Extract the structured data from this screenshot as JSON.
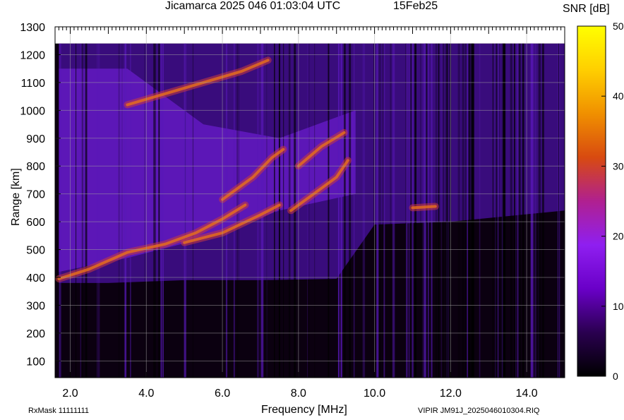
{
  "title": {
    "left": "Jicamarca 2025 046 01:03:04 UTC",
    "right": "15Feb25"
  },
  "footer": {
    "left": "RxMask 11111111",
    "right": "VIPIR  JM91J_2025046010304.RIQ"
  },
  "chart_data": {
    "type": "heatmap",
    "title": "Jicamarca 2025 046 01:03:04 UTC",
    "xlabel": "Frequency [MHz]",
    "ylabel": "Range [km]",
    "xlim": [
      1.6,
      15.0
    ],
    "ylim": [
      40,
      1300
    ],
    "x_ticks": [
      2.0,
      4.0,
      6.0,
      8.0,
      10.0,
      12.0,
      14.0
    ],
    "x_tick_labels": [
      "2.0",
      "4.0",
      "6.0",
      "8.0",
      "10.0",
      "12.0",
      "14.0"
    ],
    "y_ticks": [
      100,
      200,
      300,
      400,
      500,
      600,
      700,
      800,
      900,
      1000,
      1100,
      1200,
      1300
    ],
    "y_tick_labels": [
      "100",
      "200",
      "300",
      "400",
      "500",
      "600",
      "700",
      "800",
      "900",
      "1000",
      "1100",
      "1200",
      "1300"
    ],
    "grid": true,
    "data_range_max_km": 1240,
    "colorbar": {
      "label": "SNR [dB]",
      "min": 0,
      "max": 50,
      "ticks": [
        0,
        10,
        20,
        30,
        40,
        50
      ],
      "tick_labels": [
        "0",
        "10",
        "20",
        "30",
        "40",
        "50"
      ],
      "colors": [
        "#000000",
        "#2a0050",
        "#6a00c8",
        "#8f1ff0",
        "#b02090",
        "#d84a10",
        "#f09000",
        "#ffcf00",
        "#ffff00"
      ]
    },
    "traces": [
      {
        "x": [
          1.7,
          2.5,
          3.5,
          4.5,
          5.3,
          6.0,
          6.6
        ],
        "y": [
          395,
          430,
          490,
          520,
          560,
          610,
          660
        ]
      },
      {
        "x": [
          5.0,
          6.0,
          7.0,
          7.5
        ],
        "y": [
          525,
          560,
          625,
          660
        ]
      },
      {
        "x": [
          6.0,
          6.8,
          7.3,
          7.6
        ],
        "y": [
          680,
          760,
          830,
          860
        ]
      },
      {
        "x": [
          7.8,
          8.4,
          9.0,
          9.3
        ],
        "y": [
          640,
          700,
          760,
          820
        ]
      },
      {
        "x": [
          8.0,
          8.6,
          9.2
        ],
        "y": [
          800,
          870,
          920
        ]
      },
      {
        "x": [
          11.0,
          11.6
        ],
        "y": [
          650,
          655
        ]
      },
      {
        "x": [
          3.5,
          5.0,
          6.5,
          7.2
        ],
        "y": [
          1020,
          1080,
          1140,
          1180
        ]
      }
    ],
    "noise_floor_boundary": {
      "x": [
        1.7,
        3.0,
        5.0,
        7.0,
        9.0,
        10.0,
        12.0,
        15.0
      ],
      "y": [
        380,
        380,
        390,
        390,
        395,
        590,
        600,
        640
      ]
    }
  }
}
